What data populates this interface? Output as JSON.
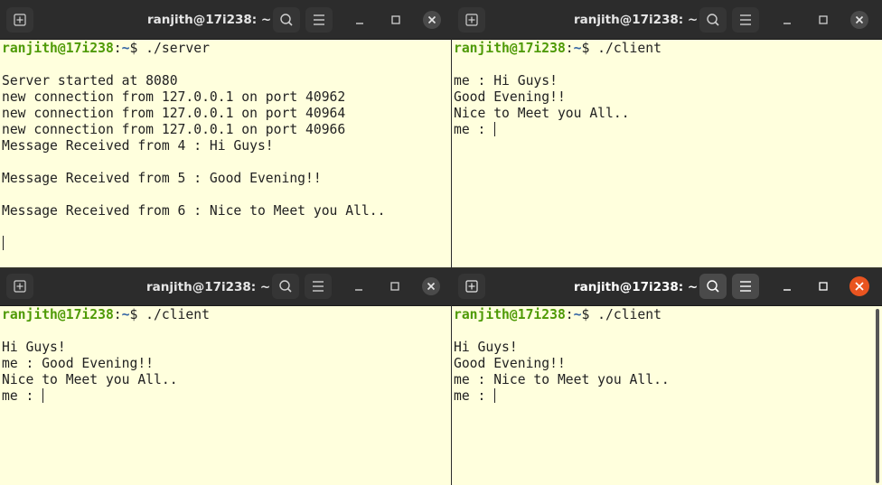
{
  "windows": [
    {
      "id": "server",
      "title": "ranjith@17i238: ~",
      "prompt_user": "ranjith@17i238",
      "prompt_sep": ":",
      "prompt_path": "~",
      "prompt_symbol": "$ ",
      "command": "./server",
      "output": [
        "",
        "Server started at 8080",
        "new connection from 127.0.0.1 on port 40962",
        "new connection from 127.0.0.1 on port 40964",
        "new connection from 127.0.0.1 on port 40966",
        "Message Received from 4 : Hi Guys!",
        "",
        "Message Received from 5 : Good Evening!!",
        "",
        "Message Received from 6 : Nice to Meet you All..",
        "",
        ""
      ]
    },
    {
      "id": "client-1",
      "title": "ranjith@17i238: ~",
      "prompt_user": "ranjith@17i238",
      "prompt_sep": ":",
      "prompt_path": "~",
      "prompt_symbol": "$ ",
      "command": "./client",
      "output": [
        "",
        "me : Hi Guys!",
        "Good Evening!!",
        "Nice to Meet you All..",
        "me : "
      ]
    },
    {
      "id": "client-2",
      "title": "ranjith@17i238: ~",
      "prompt_user": "ranjith@17i238",
      "prompt_sep": ":",
      "prompt_path": "~",
      "prompt_symbol": "$ ",
      "command": "./client",
      "output": [
        "",
        "Hi Guys!",
        "me : Good Evening!!",
        "Nice to Meet you All..",
        "me : "
      ]
    },
    {
      "id": "client-3",
      "title": "ranjith@17i238: ~",
      "prompt_user": "ranjith@17i238",
      "prompt_sep": ":",
      "prompt_path": "~",
      "prompt_symbol": "$ ",
      "command": "./client",
      "output": [
        "",
        "Hi Guys!",
        "Good Evening!!",
        "me : Nice to Meet you All..",
        "me : "
      ]
    }
  ],
  "icons": {
    "new_tab": "new-tab-icon",
    "search": "search-icon",
    "menu": "hamburger-menu-icon",
    "minimize": "minimize-icon",
    "maximize": "maximize-icon",
    "close": "close-icon"
  },
  "colors": {
    "terminal_bg": "#ffffdd",
    "titlebar_bg": "#2c2c2c",
    "prompt_user": "#4e9a06",
    "prompt_path": "#3465a4",
    "close_active": "#e95420"
  }
}
